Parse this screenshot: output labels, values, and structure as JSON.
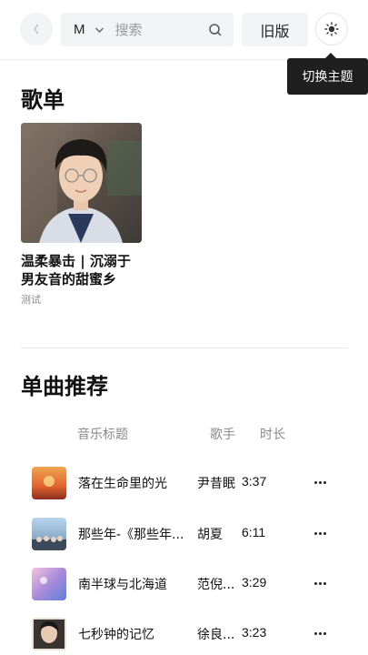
{
  "header": {
    "search_type": "M",
    "search_placeholder": "搜索",
    "search_value": "",
    "old_version_label": "旧版",
    "theme_tooltip": "切换主题"
  },
  "playlists": {
    "title": "歌单",
    "items": [
      {
        "name": "温柔暴击 | 沉溺于男友音的甜蜜乡",
        "subtitle": "测试"
      }
    ]
  },
  "songs": {
    "title": "单曲推荐",
    "columns": {
      "title": "音乐标题",
      "artist": "歌手",
      "duration": "时长"
    },
    "rows": [
      {
        "title": "落在生命里的光",
        "artist": "尹昔眠",
        "duration": "3:37"
      },
      {
        "title": "那些年-《那些年...",
        "artist": "胡夏",
        "duration": "6:11"
      },
      {
        "title": "南半球与北海道",
        "artist": "范倪...",
        "duration": "3:29"
      },
      {
        "title": "七秒钟的记忆",
        "artist": "徐良...",
        "duration": "3:23"
      }
    ]
  },
  "icons": {
    "back": "chevron-left-icon",
    "dropdown": "chevron-down-icon",
    "search": "search-icon",
    "theme": "sun-icon",
    "more": "more-icon"
  }
}
